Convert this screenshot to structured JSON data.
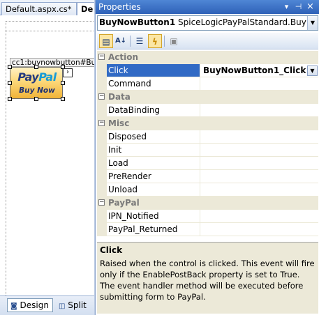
{
  "designer": {
    "tabs": [
      {
        "label": "Default.aspx.cs*"
      },
      {
        "label": "De"
      }
    ],
    "control_tag": "cc1:buynowbutton#Bu",
    "paypal": {
      "logo_pay": "Pay",
      "logo_pal": "Pal",
      "buy_now": "Buy Now"
    },
    "view_buttons": {
      "design": "Design",
      "split": "Split"
    }
  },
  "properties": {
    "title": "Properties",
    "title_buttons": {
      "dropdown": "▾",
      "pin": "⊣",
      "close": "×"
    },
    "object": {
      "name": "BuyNowButton1",
      "type": "SpiceLogicPayPalStandard.BuyNowBu"
    },
    "categories": [
      {
        "name": "Action",
        "items": [
          {
            "name": "Click",
            "value": "BuyNowButton1_Click",
            "selected": true
          },
          {
            "name": "Command",
            "value": ""
          }
        ]
      },
      {
        "name": "Data",
        "items": [
          {
            "name": "DataBinding",
            "value": ""
          }
        ]
      },
      {
        "name": "Misc",
        "items": [
          {
            "name": "Disposed",
            "value": ""
          },
          {
            "name": "Init",
            "value": ""
          },
          {
            "name": "Load",
            "value": ""
          },
          {
            "name": "PreRender",
            "value": ""
          },
          {
            "name": "Unload",
            "value": ""
          }
        ]
      },
      {
        "name": "PayPal",
        "items": [
          {
            "name": "IPN_Notified",
            "value": ""
          },
          {
            "name": "PayPal_Returned",
            "value": ""
          }
        ]
      }
    ],
    "description": {
      "title": "Click",
      "text": "Raised when the control is clicked. This event will fire only if the EnablePostBack property is set to True. The event handler method will be executed before submitting form to PayPal."
    }
  },
  "icons": {
    "categorized": "categorized-icon",
    "alphabetical": "alphabetical-icon",
    "properties": "properties-icon",
    "events": "events-lightning-icon",
    "property_pages": "property-pages-icon"
  }
}
